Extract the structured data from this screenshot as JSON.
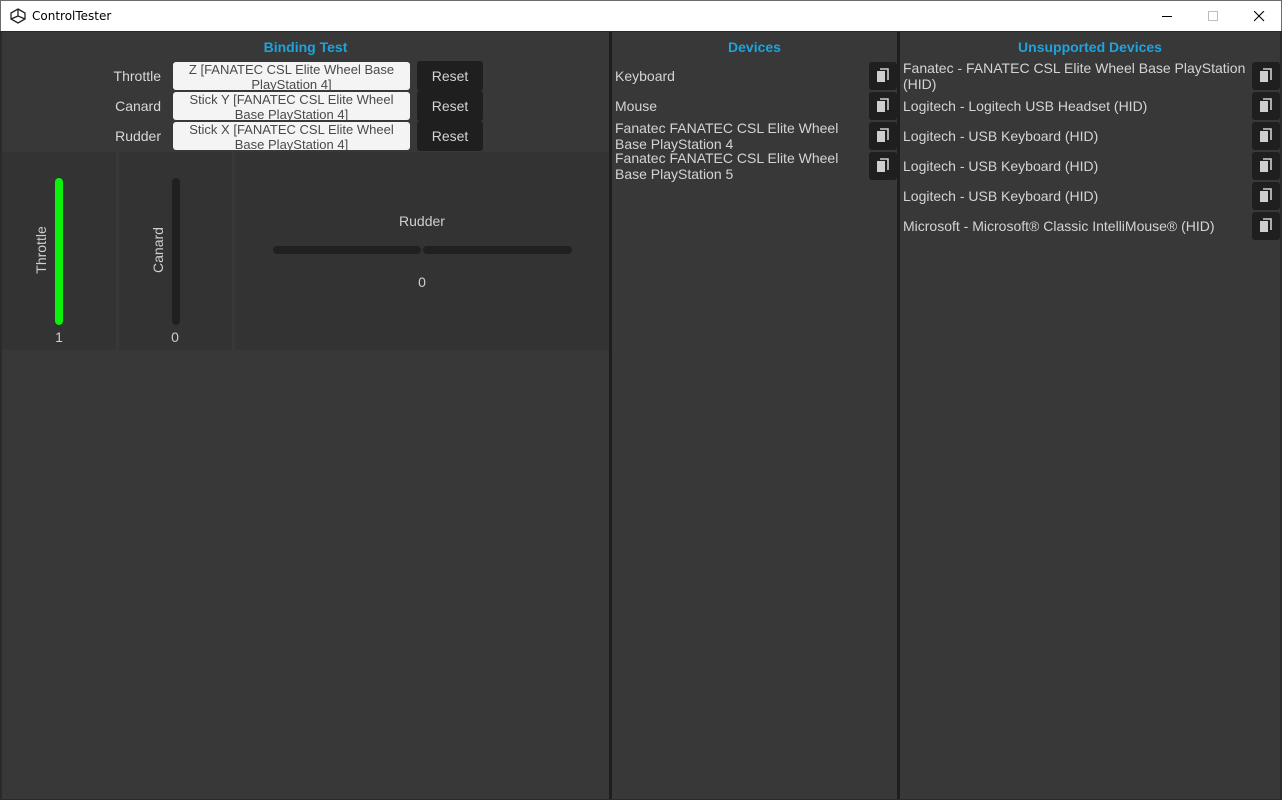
{
  "window": {
    "title": "ControlTester"
  },
  "binding_test": {
    "title": "Binding Test",
    "rows": [
      {
        "label": "Throttle",
        "binding": "Z [FANATEC CSL Elite Wheel Base PlayStation 4]",
        "reset_label": "Reset"
      },
      {
        "label": "Canard",
        "binding": "Stick Y [FANATEC CSL Elite Wheel Base PlayStation 4]",
        "reset_label": "Reset"
      },
      {
        "label": "Rudder",
        "binding": "Stick X [FANATEC CSL Elite Wheel Base PlayStation 4]",
        "reset_label": "Reset"
      }
    ],
    "visualizers": {
      "throttle": {
        "label": "Throttle",
        "value": "1",
        "fill_fraction": 1.0,
        "fill_color": "#0cf10c"
      },
      "canard": {
        "label": "Canard",
        "value": "0",
        "fill_fraction": 0.0
      },
      "rudder": {
        "label": "Rudder",
        "value": "0",
        "fill_fraction": 0.0
      }
    }
  },
  "devices": {
    "title": "Devices",
    "items": [
      {
        "name": "Keyboard",
        "icon": "copy-icon"
      },
      {
        "name": "Mouse",
        "icon": "copy-icon"
      },
      {
        "name": "Fanatec FANATEC CSL Elite Wheel Base PlayStation 4",
        "icon": "copy-icon"
      },
      {
        "name": "Fanatec FANATEC CSL Elite Wheel Base PlayStation 5",
        "icon": "copy-icon"
      }
    ]
  },
  "unsupported_devices": {
    "title": "Unsupported Devices",
    "items": [
      {
        "name": "Fanatec - FANATEC CSL Elite Wheel Base PlayStation (HID)",
        "icon": "copy-icon"
      },
      {
        "name": "Logitech - Logitech USB Headset (HID)",
        "icon": "copy-icon"
      },
      {
        "name": "Logitech - USB Keyboard (HID)",
        "icon": "copy-icon"
      },
      {
        "name": "Logitech - USB Keyboard (HID)",
        "icon": "copy-icon"
      },
      {
        "name": "Logitech - USB Keyboard (HID)",
        "icon": "copy-icon"
      },
      {
        "name": "Microsoft - Microsoft® Classic IntelliMouse® (HID)",
        "icon": "copy-icon"
      }
    ]
  },
  "colors": {
    "accent": "#1fa3dc",
    "panel": "#383838",
    "active_bar": "#0cf10c"
  }
}
